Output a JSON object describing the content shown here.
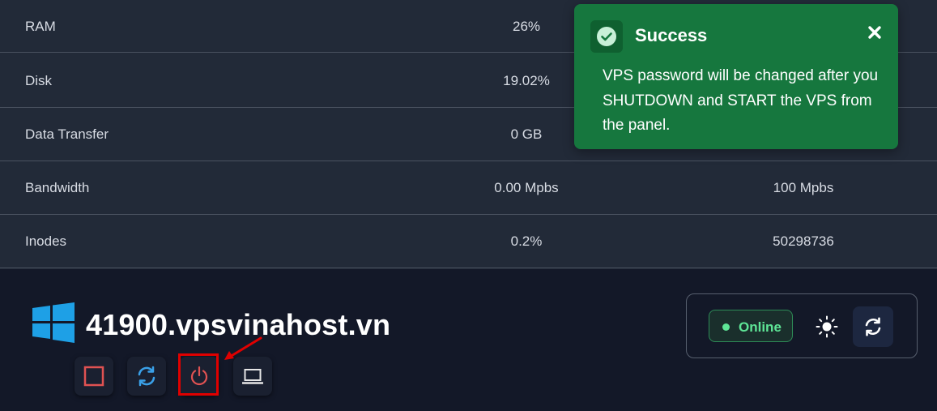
{
  "stats": {
    "rows": [
      {
        "label": "RAM",
        "value": "26%",
        "limit": ""
      },
      {
        "label": "Disk",
        "value": "19.02%",
        "limit": ""
      },
      {
        "label": "Data Transfer",
        "value": "0 GB",
        "limit": ""
      },
      {
        "label": "Bandwidth",
        "value": "0.00 Mpbs",
        "limit": "100 Mpbs"
      },
      {
        "label": "Inodes",
        "value": "0.2%",
        "limit": "50298736"
      }
    ]
  },
  "toast": {
    "title": "Success",
    "message": "VPS password will be changed after you SHUTDOWN and START the VPS from the panel.",
    "icon": "check-circle-icon",
    "close_icon": "close-icon",
    "color": "#16773e"
  },
  "server": {
    "hostname": "41900.vpsvinahost.vn",
    "os_icon": "windows-logo-icon",
    "actions": [
      {
        "name": "stop",
        "icon": "stop-square-icon",
        "color": "#e05252"
      },
      {
        "name": "restart",
        "icon": "restart-icon",
        "color": "#3aa0e8"
      },
      {
        "name": "power",
        "icon": "power-icon",
        "color": "#e05252"
      },
      {
        "name": "console",
        "icon": "laptop-icon",
        "color": "#e6e6e6"
      }
    ]
  },
  "status": {
    "label": "Online",
    "color": "#5ee596",
    "theme_icon": "sun-icon",
    "refresh_icon": "refresh-icon"
  }
}
